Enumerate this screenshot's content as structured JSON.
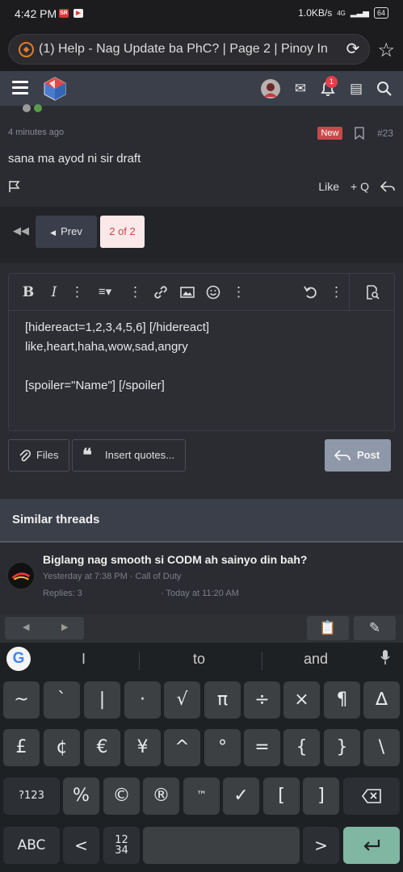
{
  "status_bar": {
    "time": "4:42 PM",
    "speed": "1.0KB/s",
    "network": "4G",
    "battery": "64"
  },
  "browser": {
    "url_title": "(1) Help - Nag Update ba PhC? | Page 2 | Pinoy In",
    "star_icon": "star-icon",
    "reload_icon": "reload-icon"
  },
  "site_nav": {
    "notification_count": "1"
  },
  "post": {
    "time": "4 minutes ago",
    "badge": "New",
    "number": "#23",
    "body": "sana ma ayod ni sir draft",
    "like": "Like",
    "quote": "+ Q"
  },
  "pager": {
    "prev": "Prev",
    "current": "2 of 2"
  },
  "editor": {
    "content": "[hidereact=1,2,3,4,5,6] [/hidereact]\nlike,heart,haha,wow,sad,angry\n\n[spoiler=\"Name\"] [/spoiler]",
    "files": "Files",
    "insert_quotes": "Insert quotes...",
    "post": "Post"
  },
  "similar": {
    "heading": "Similar threads",
    "thread_title": "Biglang nag smooth si CODM ah sainyo din bah?",
    "thread_meta": "Yesterday at 7:38 PM · Call of Duty",
    "replies": "Replies: 3",
    "last_post": "· Today at 11:20 AM"
  },
  "keyboard": {
    "suggestions": [
      "I",
      "to",
      "and"
    ],
    "row1": [
      "~",
      "`",
      "|",
      "·",
      "√",
      "π",
      "÷",
      "×",
      "¶",
      "∆"
    ],
    "row2": [
      "£",
      "¢",
      "€",
      "¥",
      "^",
      "°",
      "=",
      "{",
      "}",
      "\\"
    ],
    "row3": [
      "?123",
      "%",
      "©",
      "®",
      "™",
      "✓",
      "[",
      "]"
    ],
    "abc": "ABC",
    "lt": "<",
    "nums": "12\n34",
    "gt": ">"
  },
  "colors": {
    "accent_red": "#c74a4a",
    "nav_bg": "#3b3f4a",
    "page_bg": "#222428"
  }
}
